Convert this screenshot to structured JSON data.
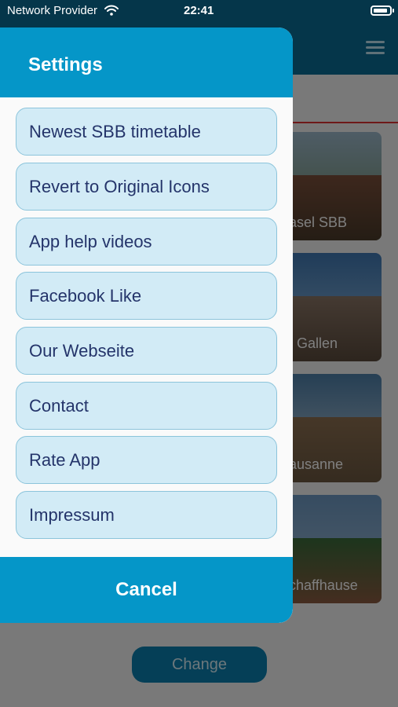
{
  "status_bar": {
    "carrier": "Network Provider",
    "time": "22:41"
  },
  "background": {
    "cards": [
      {
        "label": "asel SBB"
      },
      {
        "label": ". Gallen"
      },
      {
        "label": "ausanne"
      },
      {
        "label": "chaffhause"
      }
    ],
    "change_button": "Change",
    "colors": {
      "header": "#0a6c94",
      "accent_line": "#dd3333"
    }
  },
  "sheet": {
    "title": "Settings",
    "options": [
      "Newest SBB timetable",
      "Revert to Original Icons",
      "App help videos",
      "Facebook Like",
      "Our Webseite",
      "Contact",
      "Rate App",
      "Impressum"
    ],
    "cancel_label": "Cancel",
    "colors": {
      "header": "#0596c8",
      "option_bg": "#d2ebf6",
      "option_text": "#24346a"
    }
  }
}
